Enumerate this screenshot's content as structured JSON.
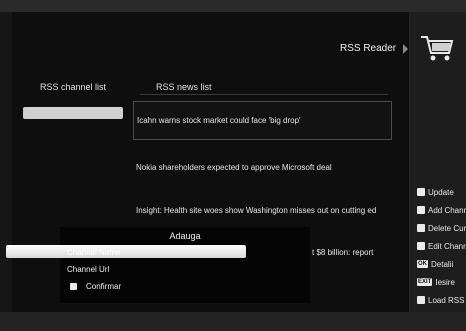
{
  "app": {
    "title": "RSS Reader"
  },
  "columns": {
    "channels_header": "RSS channel list",
    "news_header": "RSS news list"
  },
  "news": [
    "Icahn warns stock market could face 'big drop'",
    "Nokia shareholders expected to approve Microsoft deal",
    "Insight: Health site woes show Washington misses out on cutting ed"
  ],
  "news_partial": "t $8 billion: report",
  "menu": {
    "items": [
      {
        "type": "square",
        "label": "Update"
      },
      {
        "type": "square",
        "label": "Add Chann"
      },
      {
        "type": "square",
        "label": "Delete Cur"
      },
      {
        "type": "square",
        "label": "Edit Chann"
      },
      {
        "type": "key",
        "key": "OK",
        "label": "Detalii"
      },
      {
        "type": "key",
        "key": "EXIT",
        "label": "Iesire"
      },
      {
        "type": "square",
        "label": "Load RSS"
      }
    ]
  },
  "dialog": {
    "title": "Adauga",
    "channel_name_label": "Channel Name",
    "channel_url_label": "Channel Url",
    "confirm_label": "Confirmar"
  },
  "colors": {
    "background": "#0e0e0e",
    "highlight": "#cfcfcf",
    "text": "#e6e6e6"
  }
}
